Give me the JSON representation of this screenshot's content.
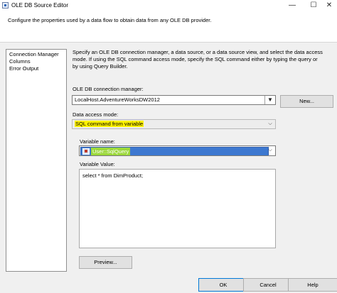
{
  "window": {
    "title": "OLE DB Source Editor",
    "min_glyph": "—",
    "max_glyph": "☐",
    "close_glyph": "✕"
  },
  "description": "Configure the properties used by a data flow to obtain data from any OLE DB provider.",
  "nav": {
    "items": [
      "Connection Manager",
      "Columns",
      "Error Output"
    ]
  },
  "main": {
    "intro": "Specify an OLE DB connection manager, a data source, or a data source view, and select the data access mode. If using the SQL command access mode, specify the SQL command either by typing the query or by using Query Builder.",
    "connection_manager_label": "OLE DB connection manager:",
    "connection_manager_value": "LocalHost.AdventureWorksDW2012",
    "new_button": "New...",
    "data_access_label": "Data access mode:",
    "data_access_value": "SQL command from variable",
    "variable_name_label": "Variable name:",
    "variable_name_value": "User::SqlQuery",
    "variable_value_label": "Variable Value:",
    "variable_value": "select * from DimProduct;",
    "preview_button": "Preview..."
  },
  "footer": {
    "ok": "OK",
    "cancel": "Cancel",
    "help": "Help"
  },
  "colors": {
    "highlight_yellow": "#fff200",
    "selection_blue": "#3d78d0",
    "highlight_green": "#9bd83a"
  },
  "icons": {
    "variable": "variable-icon",
    "dropdown": "chevron-down-icon"
  }
}
